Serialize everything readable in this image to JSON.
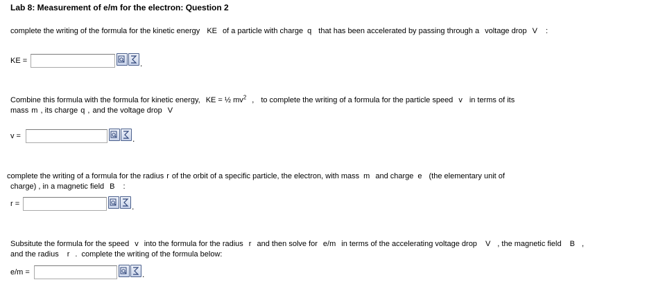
{
  "title": "Lab 8: Measurement of e/m for the electron: Question 2",
  "q1": {
    "t1": "complete the writing of the formula for the kinetic energy",
    "v1": "KE",
    "t2": "of a particle with charge",
    "v2": "q",
    "t3": "that has been accelerated by passing through a",
    "t4": "voltage drop",
    "v3": "V",
    "t5": ":",
    "label": "KE =",
    "value": "",
    "period": "."
  },
  "q2": {
    "t1": "Combine this formula with the formula for kinetic energy,",
    "ke": "KE = ½ mv",
    "sup": "2",
    "comma": ",",
    "t2": "to complete the writing of a formula for the particle speed",
    "v1": "v",
    "t3": "in terms of its",
    "t4": "mass",
    "v2": "m",
    "t5": ", its charge",
    "v3": "q",
    "t6": ",",
    "t7": "and the voltage drop",
    "v4": "V",
    "label": "v =",
    "value": "",
    "period": "."
  },
  "q3": {
    "t1": "complete the writing of a formula for the radius",
    "v1": "r",
    "t2": "of the orbit of a specific particle, the electron, with mass",
    "v2": "m",
    "t3": "and charge",
    "v3": "e",
    "t4": "(the elementary unit of",
    "t5": "charge) , in a magnetic field",
    "v4": "B",
    "t6": ":",
    "label": "r =",
    "value": "",
    "period": "."
  },
  "q4": {
    "t1": "Subsitute the formula for the speed",
    "v1": "v",
    "t2": "into the formula for the radius",
    "v2": "r",
    "t3": "and then solve for",
    "v3": "e/m",
    "t4": "in terms of the accelerating voltage drop",
    "v4": "V",
    "t5": ", the magnetic field",
    "v5": "B",
    "t6": ",",
    "t7": "and the radius",
    "v6": "r",
    "t8": ".",
    "t9": "complete the writing of the formula below:",
    "label": "e/m =",
    "value": "",
    "period": "."
  },
  "icons": {
    "preview": "formula-preview-icon",
    "editor": "equation-editor-icon"
  }
}
